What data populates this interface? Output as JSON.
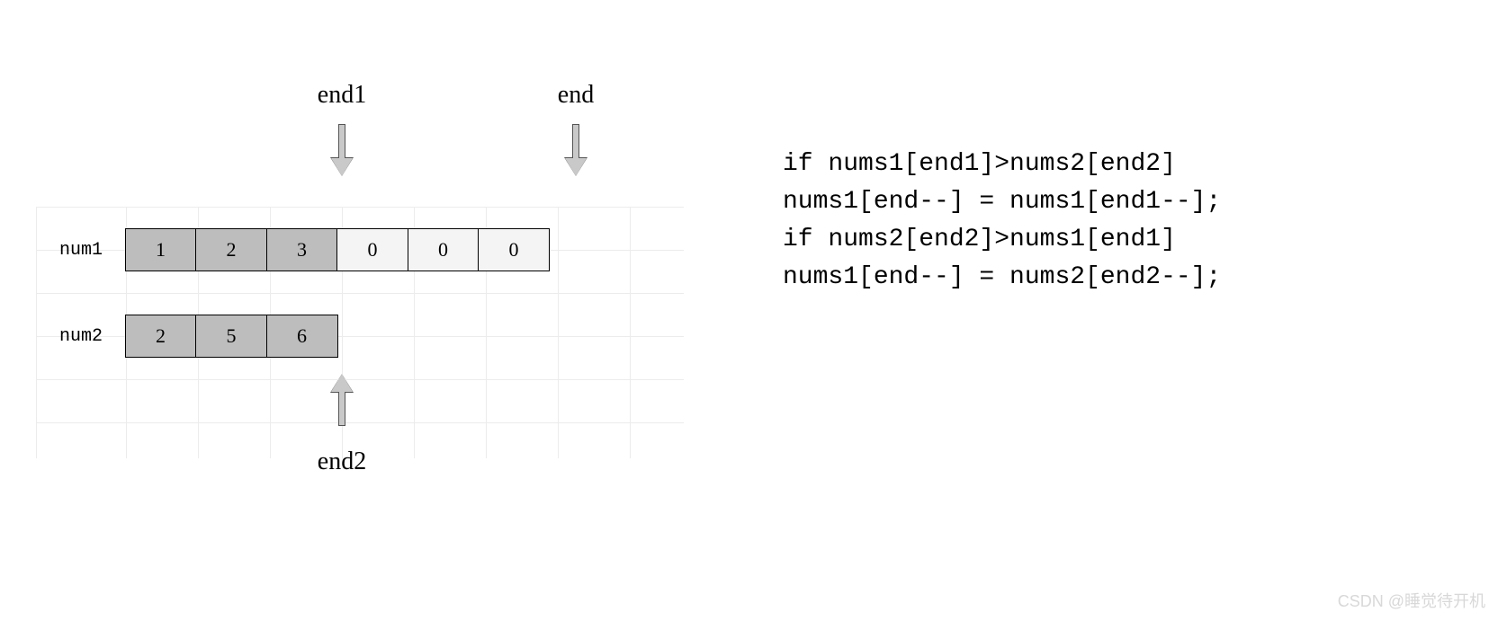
{
  "pointers": {
    "end1": {
      "label": "end1"
    },
    "end": {
      "label": "end"
    },
    "end2": {
      "label": "end2"
    }
  },
  "arrays": {
    "num1": {
      "label": "num1",
      "cells": [
        {
          "value": "1",
          "filled": true
        },
        {
          "value": "2",
          "filled": true
        },
        {
          "value": "3",
          "filled": true
        },
        {
          "value": "0",
          "filled": false
        },
        {
          "value": "0",
          "filled": false
        },
        {
          "value": "0",
          "filled": false
        }
      ]
    },
    "num2": {
      "label": "num2",
      "cells": [
        {
          "value": "2",
          "filled": true
        },
        {
          "value": "5",
          "filled": true
        },
        {
          "value": "6",
          "filled": true
        }
      ]
    }
  },
  "code": {
    "line1": "if nums1[end1]>nums2[end2]",
    "line2": "nums1[end--] = nums1[end1--];",
    "line3": "if nums2[end2]>nums1[end1]",
    "line4": "nums1[end--] = nums2[end2--];"
  },
  "watermark": "CSDN @睡觉待开机"
}
